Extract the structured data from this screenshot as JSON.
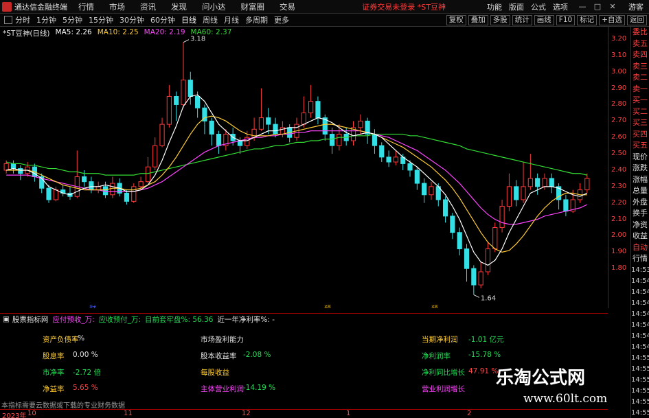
{
  "app": {
    "title": "通达信金融终端",
    "menu": [
      "行情",
      "市场",
      "资讯",
      "发现",
      "问小达",
      "财富圈",
      "交易"
    ],
    "notice": "证券交易未登录  *ST豆神",
    "right_menu": [
      "功能",
      "版面",
      "公式",
      "选项"
    ],
    "window_buttons": [
      "—",
      "□",
      "✕"
    ],
    "guest": "游客"
  },
  "toolbar": {
    "periods": [
      "分时",
      "1分钟",
      "5分钟",
      "15分钟",
      "30分钟",
      "60分钟",
      "日线",
      "周线",
      "月线",
      "多周期",
      "更多"
    ],
    "active_period": "日线",
    "tools": [
      "复权",
      "叠加",
      "多股",
      "统计",
      "画线",
      "F10",
      "标记",
      "+自选",
      "返回"
    ]
  },
  "chart": {
    "stock_label": "*ST豆神(日线)",
    "ma": [
      {
        "name": "MA5",
        "value": "2.26",
        "color": "#ffffff"
      },
      {
        "name": "MA10",
        "value": "2.25",
        "color": "#ffcc33"
      },
      {
        "name": "MA20",
        "value": "2.19",
        "color": "#ff44ff"
      },
      {
        "name": "MA60",
        "value": "2.37",
        "color": "#33dd33"
      }
    ],
    "price_ticks": [
      "3.20",
      "3.10",
      "3.00",
      "2.90",
      "2.80",
      "2.70",
      "2.60",
      "2.50",
      "2.40",
      "2.30",
      "2.20",
      "2.10",
      "2.00",
      "1.90",
      "1.80"
    ],
    "high_label": "3.18",
    "low_label": "1.64",
    "event_markers": [
      "财",
      "预",
      "预"
    ]
  },
  "chart_data": {
    "type": "candlestick",
    "ylim": [
      1.6,
      3.25
    ],
    "candles": [
      [
        2.4,
        2.44,
        2.46,
        2.38
      ],
      [
        2.44,
        2.41,
        2.46,
        2.38
      ],
      [
        2.41,
        2.38,
        2.43,
        2.34
      ],
      [
        2.38,
        2.42,
        2.45,
        2.36
      ],
      [
        2.42,
        2.36,
        2.44,
        2.33
      ],
      [
        2.36,
        2.29,
        2.38,
        2.26
      ],
      [
        2.29,
        2.22,
        2.31,
        2.2
      ],
      [
        2.22,
        2.28,
        2.3,
        2.21
      ],
      [
        2.28,
        2.26,
        2.31,
        2.24
      ],
      [
        2.26,
        2.24,
        2.3,
        2.22
      ],
      [
        2.24,
        2.36,
        2.52,
        2.23
      ],
      [
        2.36,
        2.33,
        2.4,
        2.3
      ],
      [
        2.33,
        2.28,
        2.36,
        2.26
      ],
      [
        2.28,
        2.3,
        2.33,
        2.26
      ],
      [
        2.3,
        2.25,
        2.33,
        2.23
      ],
      [
        2.25,
        2.32,
        2.36,
        2.23
      ],
      [
        2.32,
        2.26,
        2.35,
        2.24
      ],
      [
        2.26,
        2.21,
        2.28,
        2.19
      ],
      [
        2.21,
        2.3,
        2.32,
        2.2
      ],
      [
        2.3,
        2.33,
        2.36,
        2.28
      ],
      [
        2.33,
        2.42,
        2.48,
        2.32
      ],
      [
        2.42,
        2.55,
        2.6,
        2.4
      ],
      [
        2.55,
        2.68,
        2.72,
        2.54
      ],
      [
        2.68,
        2.85,
        2.92,
        2.66
      ],
      [
        2.85,
        2.8,
        2.88,
        2.7
      ],
      [
        2.8,
        2.95,
        3.18,
        2.78
      ],
      [
        2.95,
        2.85,
        3.0,
        2.8
      ],
      [
        2.85,
        2.78,
        2.88,
        2.72
      ],
      [
        2.78,
        2.7,
        2.8,
        2.62
      ],
      [
        2.7,
        2.62,
        2.72,
        2.55
      ],
      [
        2.62,
        2.55,
        2.64,
        2.5
      ],
      [
        2.55,
        2.62,
        2.65,
        2.52
      ],
      [
        2.62,
        2.58,
        2.66,
        2.55
      ],
      [
        2.58,
        2.55,
        2.6,
        2.5
      ],
      [
        2.55,
        2.6,
        2.64,
        2.53
      ],
      [
        2.6,
        2.65,
        2.72,
        2.58
      ],
      [
        2.65,
        2.72,
        2.9,
        2.64
      ],
      [
        2.72,
        2.68,
        2.78,
        2.62
      ],
      [
        2.68,
        2.62,
        2.72,
        2.6
      ],
      [
        2.62,
        2.66,
        2.7,
        2.6
      ],
      [
        2.66,
        2.6,
        2.68,
        2.57
      ],
      [
        2.6,
        2.68,
        2.72,
        2.58
      ],
      [
        2.68,
        2.75,
        2.85,
        2.66
      ],
      [
        2.75,
        2.82,
        2.92,
        2.72
      ],
      [
        2.82,
        2.72,
        2.85,
        2.68
      ],
      [
        2.72,
        2.62,
        2.74,
        2.58
      ],
      [
        2.62,
        2.55,
        2.66,
        2.5
      ],
      [
        2.55,
        2.62,
        2.68,
        2.52
      ],
      [
        2.62,
        2.58,
        2.66,
        2.55
      ],
      [
        2.58,
        2.66,
        2.7,
        2.55
      ],
      [
        2.66,
        2.7,
        2.74,
        2.62
      ],
      [
        2.7,
        2.62,
        2.72,
        2.56
      ],
      [
        2.62,
        2.55,
        2.65,
        2.5
      ],
      [
        2.55,
        2.48,
        2.57,
        2.45
      ],
      [
        2.48,
        2.45,
        2.52,
        2.42
      ],
      [
        2.45,
        2.48,
        2.52,
        2.43
      ],
      [
        2.48,
        2.44,
        2.5,
        2.4
      ],
      [
        2.44,
        2.4,
        2.46,
        2.36
      ],
      [
        2.4,
        2.32,
        2.42,
        2.28
      ],
      [
        2.32,
        2.25,
        2.35,
        2.2
      ],
      [
        2.25,
        2.3,
        2.33,
        2.22
      ],
      [
        2.3,
        2.22,
        2.32,
        2.18
      ],
      [
        2.22,
        2.12,
        2.24,
        2.08
      ],
      [
        2.12,
        2.02,
        2.14,
        1.98
      ],
      [
        2.02,
        1.92,
        2.05,
        1.88
      ],
      [
        1.92,
        1.8,
        1.95,
        1.72
      ],
      [
        1.8,
        1.7,
        1.82,
        1.64
      ],
      [
        1.7,
        1.78,
        1.84,
        1.68
      ],
      [
        1.78,
        1.92,
        1.96,
        1.76
      ],
      [
        1.92,
        2.05,
        2.08,
        1.9
      ],
      [
        2.05,
        2.18,
        2.22,
        2.02
      ],
      [
        2.18,
        2.3,
        2.38,
        2.15
      ],
      [
        2.3,
        2.22,
        2.34,
        2.18
      ],
      [
        2.22,
        2.3,
        2.45,
        2.2
      ],
      [
        2.3,
        2.35,
        2.5,
        2.28
      ],
      [
        2.35,
        2.3,
        2.38,
        2.25
      ],
      [
        2.3,
        2.35,
        2.38,
        2.28
      ],
      [
        2.35,
        2.3,
        2.38,
        2.26
      ],
      [
        2.3,
        2.22,
        2.32,
        2.16
      ],
      [
        2.22,
        2.15,
        2.25,
        2.12
      ],
      [
        2.15,
        2.22,
        2.28,
        2.14
      ],
      [
        2.22,
        2.28,
        2.32,
        2.2
      ],
      [
        2.28,
        2.35,
        2.38,
        2.26
      ]
    ],
    "ma5": [
      2.4,
      2.41,
      2.4,
      2.4,
      2.38,
      2.35,
      2.3,
      2.28,
      2.26,
      2.25,
      2.27,
      2.29,
      2.3,
      2.3,
      2.31,
      2.3,
      2.29,
      2.27,
      2.27,
      2.28,
      2.31,
      2.37,
      2.46,
      2.57,
      2.67,
      2.79,
      2.85,
      2.86,
      2.82,
      2.75,
      2.68,
      2.64,
      2.6,
      2.58,
      2.58,
      2.6,
      2.62,
      2.64,
      2.64,
      2.65,
      2.66,
      2.66,
      2.68,
      2.7,
      2.72,
      2.71,
      2.69,
      2.66,
      2.63,
      2.61,
      2.62,
      2.63,
      2.62,
      2.6,
      2.56,
      2.52,
      2.48,
      2.45,
      2.42,
      2.38,
      2.34,
      2.3,
      2.25,
      2.18,
      2.1,
      2.0,
      1.9,
      1.84,
      1.82,
      1.85,
      1.92,
      2.02,
      2.1,
      2.18,
      2.26,
      2.28,
      2.3,
      2.3,
      2.29,
      2.27,
      2.25,
      2.24,
      2.26
    ],
    "ma10": [
      2.4,
      2.4,
      2.4,
      2.4,
      2.39,
      2.37,
      2.35,
      2.33,
      2.31,
      2.3,
      2.29,
      2.28,
      2.28,
      2.28,
      2.28,
      2.29,
      2.29,
      2.28,
      2.28,
      2.29,
      2.31,
      2.33,
      2.37,
      2.42,
      2.48,
      2.55,
      2.62,
      2.68,
      2.72,
      2.73,
      2.72,
      2.7,
      2.67,
      2.64,
      2.62,
      2.61,
      2.61,
      2.61,
      2.62,
      2.62,
      2.63,
      2.64,
      2.65,
      2.66,
      2.67,
      2.68,
      2.68,
      2.67,
      2.66,
      2.65,
      2.64,
      2.63,
      2.62,
      2.6,
      2.58,
      2.56,
      2.54,
      2.51,
      2.48,
      2.45,
      2.42,
      2.38,
      2.34,
      2.29,
      2.23,
      2.16,
      2.09,
      2.02,
      1.96,
      1.92,
      1.9,
      1.91,
      1.95,
      2.0,
      2.06,
      2.12,
      2.17,
      2.21,
      2.24,
      2.26,
      2.26,
      2.25,
      2.25
    ],
    "ma20": [
      2.37,
      2.37,
      2.37,
      2.37,
      2.36,
      2.35,
      2.34,
      2.33,
      2.32,
      2.31,
      2.3,
      2.29,
      2.28,
      2.28,
      2.27,
      2.27,
      2.27,
      2.27,
      2.27,
      2.28,
      2.29,
      2.31,
      2.33,
      2.36,
      2.39,
      2.42,
      2.45,
      2.48,
      2.51,
      2.53,
      2.55,
      2.56,
      2.57,
      2.58,
      2.59,
      2.6,
      2.6,
      2.61,
      2.61,
      2.62,
      2.62,
      2.63,
      2.63,
      2.64,
      2.64,
      2.64,
      2.64,
      2.64,
      2.64,
      2.64,
      2.64,
      2.63,
      2.62,
      2.61,
      2.6,
      2.58,
      2.56,
      2.54,
      2.52,
      2.49,
      2.46,
      2.43,
      2.4,
      2.36,
      2.32,
      2.27,
      2.22,
      2.17,
      2.13,
      2.1,
      2.08,
      2.07,
      2.07,
      2.08,
      2.09,
      2.1,
      2.12,
      2.13,
      2.14,
      2.15,
      2.16,
      2.17,
      2.19
    ],
    "ma60": [
      2.45,
      2.44,
      2.44,
      2.43,
      2.43,
      2.42,
      2.41,
      2.41,
      2.4,
      2.39,
      2.39,
      2.38,
      2.38,
      2.38,
      2.37,
      2.37,
      2.37,
      2.37,
      2.37,
      2.38,
      2.38,
      2.39,
      2.4,
      2.41,
      2.42,
      2.43,
      2.44,
      2.45,
      2.46,
      2.47,
      2.48,
      2.49,
      2.5,
      2.51,
      2.52,
      2.53,
      2.53,
      2.54,
      2.55,
      2.55,
      2.56,
      2.57,
      2.57,
      2.58,
      2.58,
      2.59,
      2.59,
      2.6,
      2.6,
      2.61,
      2.61,
      2.61,
      2.62,
      2.62,
      2.62,
      2.62,
      2.62,
      2.61,
      2.61,
      2.6,
      2.59,
      2.58,
      2.57,
      2.56,
      2.55,
      2.53,
      2.52,
      2.51,
      2.5,
      2.49,
      2.48,
      2.47,
      2.46,
      2.45,
      2.44,
      2.43,
      2.42,
      2.41,
      2.4,
      2.39,
      2.38,
      2.38,
      2.37
    ]
  },
  "side_panel": {
    "labels": [
      {
        "text": "委比",
        "color": "red"
      },
      {
        "text": "卖五",
        "color": "red"
      },
      {
        "text": "卖四",
        "color": "red"
      },
      {
        "text": "卖三",
        "color": "red"
      },
      {
        "text": "卖二",
        "color": "red"
      },
      {
        "text": "卖一",
        "color": "red"
      },
      {
        "text": "买一",
        "color": "red"
      },
      {
        "text": "买二",
        "color": "red"
      },
      {
        "text": "买三",
        "color": "red"
      },
      {
        "text": "买四",
        "color": "red"
      },
      {
        "text": "买五",
        "color": "red"
      },
      {
        "text": "现价",
        "color": "white"
      },
      {
        "text": "涨跌",
        "color": "white"
      },
      {
        "text": "涨幅",
        "color": "white"
      },
      {
        "text": "总量",
        "color": "white"
      },
      {
        "text": "外盘",
        "color": "white"
      },
      {
        "text": "换手",
        "color": "white"
      },
      {
        "text": "净资",
        "color": "white"
      },
      {
        "text": "收益",
        "color": "white"
      },
      {
        "text": "自动",
        "color": "red"
      },
      {
        "text": "行情",
        "color": "white"
      }
    ],
    "times": [
      "14:53",
      "14:54",
      "14:54",
      "14:54",
      "14:54",
      "14:54",
      "14:54",
      "14:54",
      "14:55",
      "14:55",
      "14:55",
      "14:55",
      "14:55",
      "14:55",
      "14:55"
    ]
  },
  "indicator": {
    "title": "股票指标网",
    "header_items": [
      {
        "text": "应付预收_万:",
        "color": "p"
      },
      {
        "text": "应收预付_万:",
        "color": "g"
      },
      {
        "text": "目前套牢盘%: 56.36",
        "color": "g"
      },
      {
        "text": "近一年净利率%: -",
        "color": "w"
      }
    ],
    "cells": [
      {
        "label": "资产负债率",
        "value": "-  %",
        "lc": "y",
        "vc": "w",
        "col": 0,
        "row": 0
      },
      {
        "label": "股息率",
        "value": "0.00  %",
        "lc": "y",
        "vc": "w",
        "col": 0,
        "row": 1
      },
      {
        "label": "市净率",
        "value": "-2.72  倍",
        "lc": "g",
        "vc": "g",
        "col": 0,
        "row": 2
      },
      {
        "label": "净益率",
        "value": "5.65  %",
        "lc": "y",
        "vc": "r",
        "col": 0,
        "row": 3
      },
      {
        "label": "市场盈利能力",
        "value": "",
        "lc": "w",
        "vc": "w",
        "col": 1,
        "row": 0
      },
      {
        "label": "股本收益率",
        "value": "-2.08  %",
        "lc": "w",
        "vc": "g",
        "col": 1,
        "row": 1
      },
      {
        "label": "每股收益",
        "value": "",
        "lc": "y",
        "vc": "w",
        "col": 1,
        "row": 2
      },
      {
        "label": "主体营业利润",
        "value": "-14.19  %",
        "lc": "p",
        "vc": "g",
        "col": 1,
        "row": 3
      },
      {
        "label": "当期净利润",
        "value": "-1.01  亿元",
        "lc": "y",
        "vc": "g",
        "col": 2,
        "row": 0
      },
      {
        "label": "净利润率",
        "value": "-15.78  %",
        "lc": "g",
        "vc": "g",
        "col": 2,
        "row": 1
      },
      {
        "label": "净利同比增长",
        "value": "47.91  %",
        "lc": "g",
        "vc": "r",
        "col": 2,
        "row": 2
      },
      {
        "label": "营业利润增长",
        "value": "",
        "lc": "p",
        "vc": "w",
        "col": 2,
        "row": 3
      }
    ],
    "footnote": "本指标需要云数据或下载的专业财务数据"
  },
  "date_axis": [
    "2023年",
    "10",
    "11",
    "12",
    "1",
    "2"
  ],
  "watermark": {
    "title": "乐淘公式网",
    "url": "www.60lt.com"
  }
}
